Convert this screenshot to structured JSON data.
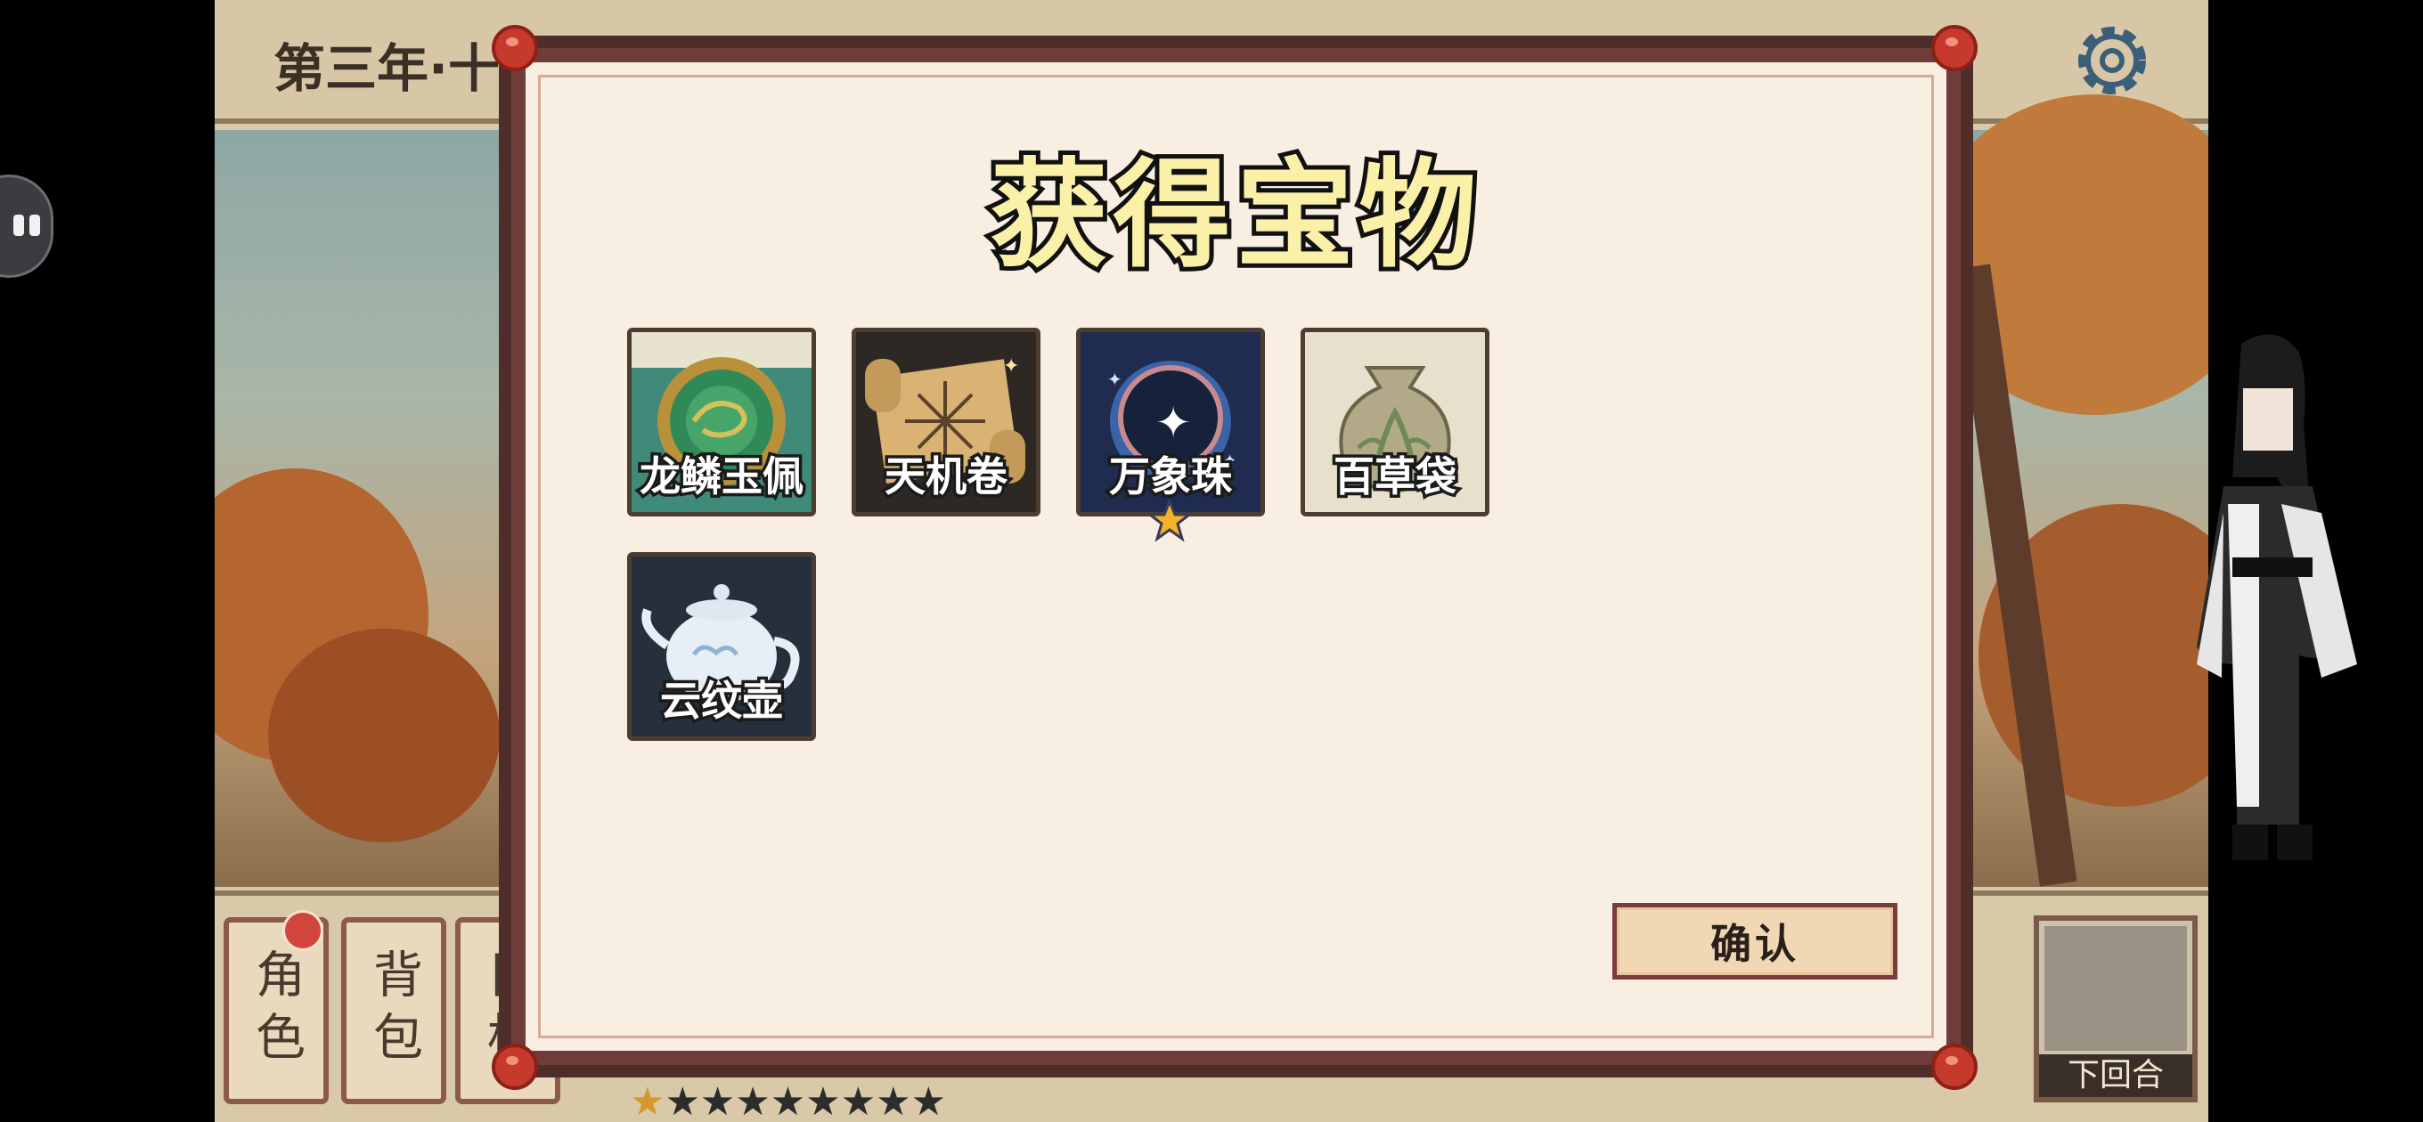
{
  "game": {
    "year_label": "第三年·十",
    "side_buttons": [
      "角色",
      "背包",
      "目标"
    ],
    "next_round_label": "下回合",
    "stars": "★★★★★★★★★"
  },
  "dialog": {
    "title": "获得宝物",
    "items": [
      {
        "name": "龙鳞玉佩",
        "icon": "jade-pendant-icon"
      },
      {
        "name": "天机卷",
        "icon": "scroll-icon"
      },
      {
        "name": "万象珠",
        "icon": "crystal-orb-icon",
        "starred": true
      },
      {
        "name": "百草袋",
        "icon": "herb-bag-icon"
      },
      {
        "name": "云纹壶",
        "icon": "cloud-teapot-icon"
      }
    ],
    "confirm_label": "确认"
  },
  "colors": {
    "frame": "#6e3d3a",
    "paper": "#f8efe2",
    "title_fill": "#fbf0a8",
    "confirm_bg": "#f2d7b5"
  }
}
